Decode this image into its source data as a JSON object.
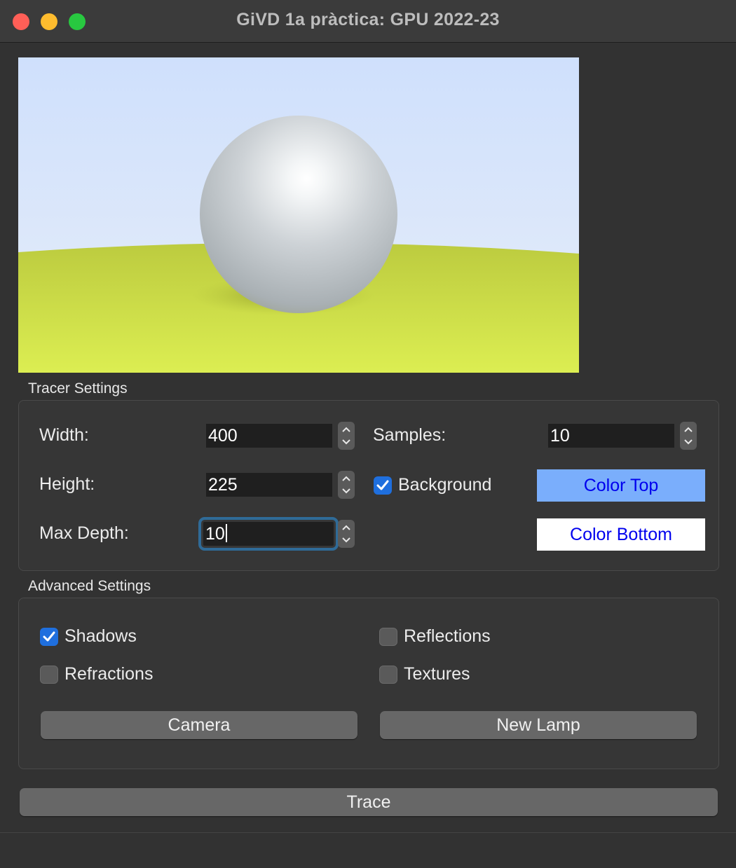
{
  "window": {
    "title": "GiVD 1a pràctica: GPU 2022-23"
  },
  "render_preview": {
    "sky_top_color": "#cfe0fc",
    "sky_bottom_color": "#e3ebfa",
    "ground_color": "#d4e34a",
    "sphere_color": "#c8ccd0"
  },
  "tracer_settings": {
    "title": "Tracer Settings",
    "width": {
      "label": "Width:",
      "value": "400"
    },
    "height": {
      "label": "Height:",
      "value": "225"
    },
    "max_depth": {
      "label": "Max Depth:",
      "value": "10"
    },
    "samples": {
      "label": "Samples:",
      "value": "10"
    },
    "background": {
      "label": "Background",
      "checked": true
    },
    "color_top": {
      "label": "Color Top",
      "color": "#7aaefc"
    },
    "color_bottom": {
      "label": "Color Bottom",
      "color": "#ffffff"
    }
  },
  "advanced_settings": {
    "title": "Advanced Settings",
    "shadows": {
      "label": "Shadows",
      "checked": true
    },
    "reflections": {
      "label": "Reflections",
      "checked": false
    },
    "refractions": {
      "label": "Refractions",
      "checked": false
    },
    "textures": {
      "label": "Textures",
      "checked": false
    },
    "camera_button": "Camera",
    "new_lamp_button": "New Lamp"
  },
  "trace_button": "Trace"
}
